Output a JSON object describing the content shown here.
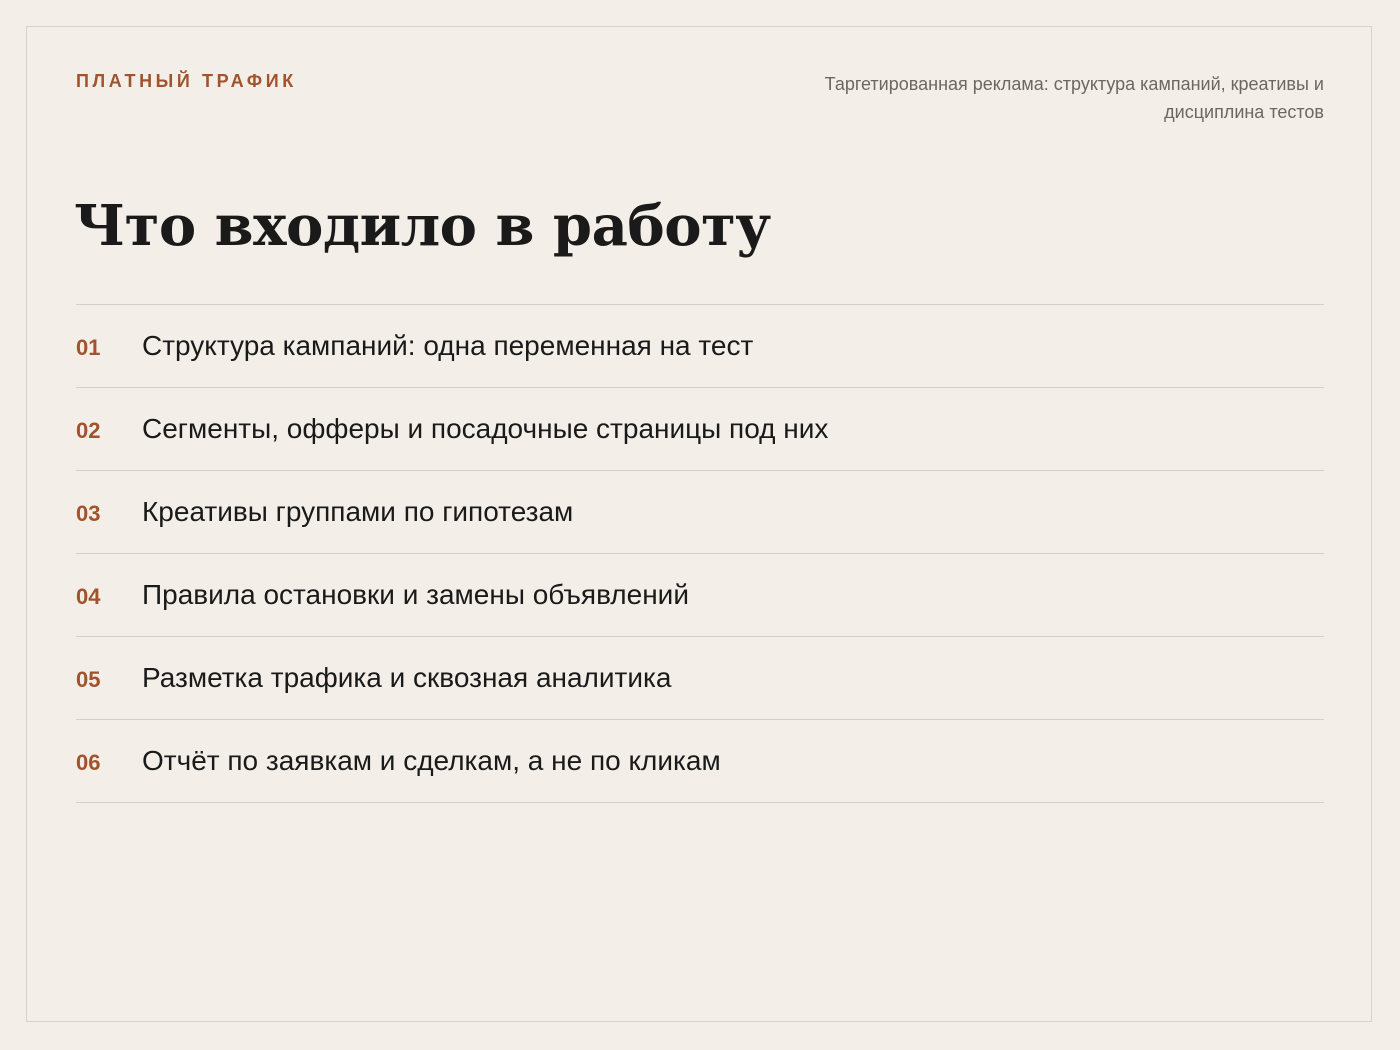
{
  "header": {
    "eyebrow": "ПЛАТНЫЙ ТРАФИК",
    "subtitle": "Таргетированная реклама: структура кампаний, креативы и дисциплина тестов"
  },
  "title": "Что входило в работу",
  "items": [
    {
      "num": "01",
      "text": "Структура кампаний: одна переменная на тест"
    },
    {
      "num": "02",
      "text": "Сегменты, офферы и посадочные страницы под них"
    },
    {
      "num": "03",
      "text": "Креативы группами по гипотезам"
    },
    {
      "num": "04",
      "text": "Правила остановки и замены объявлений"
    },
    {
      "num": "05",
      "text": "Разметка трафика и сквозная аналитика"
    },
    {
      "num": "06",
      "text": "Отчёт по заявкам и сделкам, а не по кликам"
    }
  ],
  "colors": {
    "background": "#f3eee8",
    "accent": "#a0532d",
    "text": "#1a1a1a",
    "muted": "#6d6661",
    "divider": "#d6cfc7"
  }
}
